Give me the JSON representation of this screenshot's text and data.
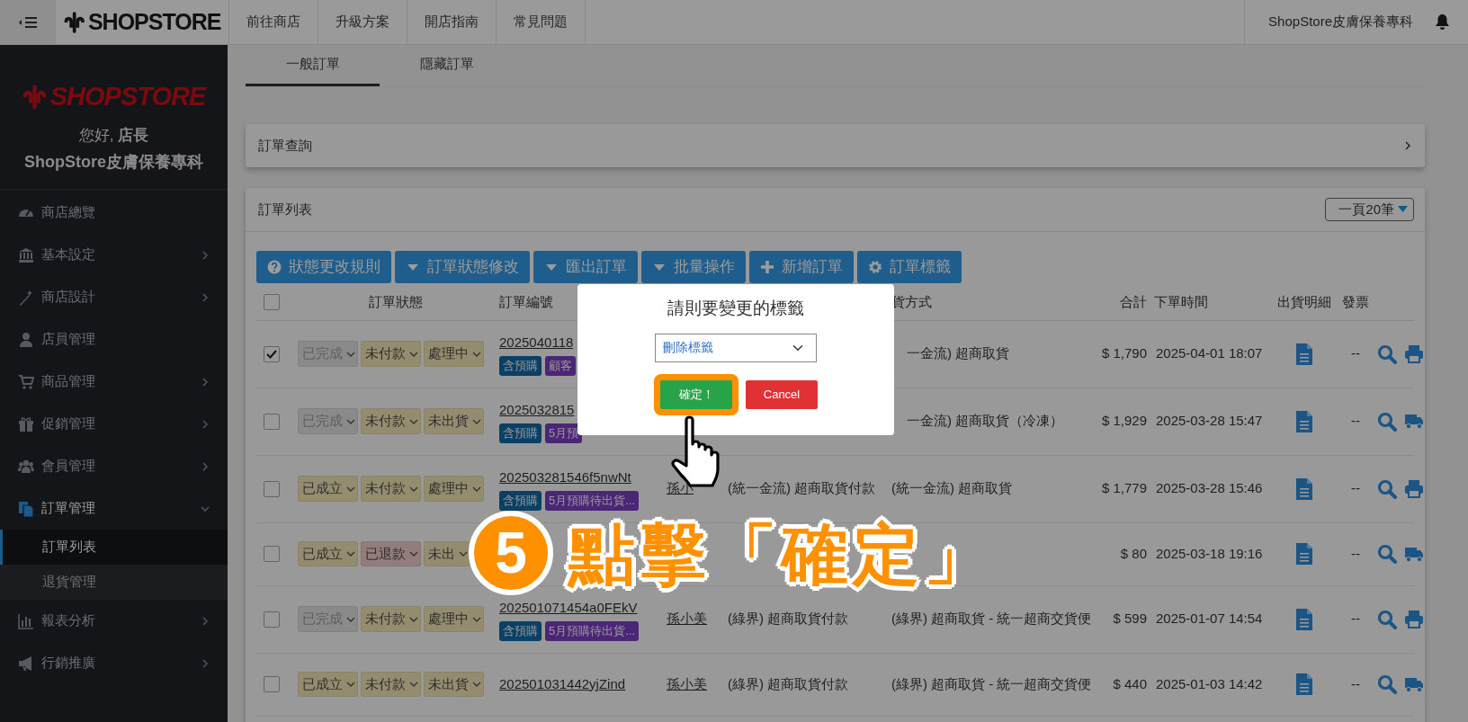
{
  "topbar": {
    "logo_text": "SHOPSTORE",
    "nav": [
      "前往商店",
      "升級方案",
      "開店指南",
      "常見問題"
    ],
    "store_name": "ShopStore皮膚保養專科"
  },
  "sidebar": {
    "logo_text": "SHOPSTORE",
    "greeting": "您好, **店長**",
    "store": "ShopStore皮膚保養專科",
    "items": [
      {
        "label": "商店總覽",
        "selected": false
      },
      {
        "label": "基本設定",
        "selected": false,
        "expanded": false
      },
      {
        "label": "商店設計",
        "selected": false,
        "expanded": false
      },
      {
        "label": "店員管理",
        "selected": false
      },
      {
        "label": "商品管理",
        "selected": false,
        "expanded": false
      },
      {
        "label": "促銷管理",
        "selected": false,
        "expanded": false
      },
      {
        "label": "會員管理",
        "selected": false,
        "expanded": false
      },
      {
        "label": "訂單管理",
        "selected": true,
        "expanded": true,
        "children": [
          {
            "label": "訂單列表",
            "selected": true
          },
          {
            "label": "退貨管理",
            "selected": false
          }
        ]
      },
      {
        "label": "報表分析",
        "selected": false,
        "expanded": false
      },
      {
        "label": "行銷推廣",
        "selected": false,
        "expanded": false
      }
    ]
  },
  "tabs": [
    {
      "label": "一般訂單",
      "selected": true
    },
    {
      "label": "隱藏訂單",
      "selected": false
    }
  ],
  "search_panel": {
    "title": "訂單查詢"
  },
  "order_list": {
    "title": "訂單列表",
    "page_size": "一頁20筆",
    "buttons": [
      "狀態更改規則",
      "訂單狀態修改",
      "匯出訂單",
      "批量操作",
      "新增訂單",
      "訂單標籤"
    ],
    "select_all": {
      "checked": false
    },
    "columns": [
      "訂單狀態",
      "訂單編號",
      "貨方式",
      "合計",
      "下單時間",
      "出貨明細",
      "發票"
    ],
    "rows": [
      {
        "checked": true,
        "statuses": [
          {
            "label": "已完成",
            "color": "#8a8a8a"
          },
          {
            "label": "未付款",
            "color": "#948c6f"
          },
          {
            "label": "處理中",
            "color": "#948c6f"
          }
        ],
        "order_id": "2025040118",
        "tags": [
          {
            "label": "含預購",
            "color": "#0a4065"
          },
          {
            "label": "顧客",
            "color": "#4c2676"
          }
        ],
        "shipping": "一金流) 超商取貨",
        "total": "$ 1,790",
        "time": "2025-04-01 18:07",
        "invoice": "--"
      },
      {
        "checked": false,
        "statuses": [
          {
            "label": "已完成",
            "color": "#8a8a8a"
          },
          {
            "label": "未付款",
            "color": "#948c6f"
          },
          {
            "label": "未出貨",
            "color": "#948c6f"
          }
        ],
        "order_id": "2025032815",
        "tags": [
          {
            "label": "含預購",
            "color": "#0a4065"
          },
          {
            "label": "5月預",
            "color": "#4c2676"
          }
        ],
        "shipping": "一金流) 超商取貨（冷凍）",
        "total": "$ 1,929",
        "time": "2025-03-28 15:47",
        "invoice": "--"
      },
      {
        "checked": false,
        "statuses": [
          {
            "label": "已成立",
            "color": "#948c6f"
          },
          {
            "label": "未付款",
            "color": "#948c6f"
          },
          {
            "label": "處理中",
            "color": "#948c6f"
          }
        ],
        "order_id": "202503281546f5nwNt",
        "tags": [
          {
            "label": "含預購",
            "color": "#0a4065"
          },
          {
            "label": "5月預購待出貨...",
            "color": "#4c2676"
          }
        ],
        "customer": "孫小",
        "payment": "(統一金流) 超商取貨付款",
        "shipping": "(統一金流) 超商取貨",
        "total": "$ 1,779",
        "time": "2025-03-28 15:46",
        "invoice": "--"
      },
      {
        "checked": false,
        "statuses": [
          {
            "label": "已成立",
            "color": "#948c6f"
          },
          {
            "label": "已退款",
            "color": "#927c7c"
          },
          {
            "label": "未出",
            "color": "#948c6f"
          }
        ],
        "tags": [],
        "total": "$ 80",
        "time": "2025-03-18 19:16",
        "invoice": "--"
      },
      {
        "checked": false,
        "statuses": [
          {
            "label": "已完成",
            "color": "#8a8a8a"
          },
          {
            "label": "未付款",
            "color": "#948c6f"
          },
          {
            "label": "處理中",
            "color": "#948c6f"
          }
        ],
        "order_id": "202501071454a0FEkV",
        "tags": [
          {
            "label": "含預購",
            "color": "#0a4065"
          },
          {
            "label": "5月預購待出貨...",
            "color": "#4c2676"
          }
        ],
        "customer": "孫小美",
        "payment": "(綠界) 超商取貨付款",
        "shipping": "(綠界) 超商取貨 - 統一超商交貨便",
        "total": "$ 599",
        "time": "2025-01-07 14:54",
        "invoice": "--"
      },
      {
        "checked": false,
        "statuses": [
          {
            "label": "已成立",
            "color": "#948c6f"
          },
          {
            "label": "未付款",
            "color": "#948c6f"
          },
          {
            "label": "未出貨",
            "color": "#948c6f"
          }
        ],
        "order_id": "202501031442yjZind",
        "tags": [],
        "customer": "孫小美",
        "payment": "(綠界) 超商取貨付款",
        "shipping": "(綠界) 超商取貨 - 統一超商交貨便",
        "total": "$ 440",
        "time": "2025-01-03 14:42",
        "invoice": "--"
      }
    ]
  },
  "modal": {
    "title": "請則要變更的標籤",
    "select_value": "刪除標籤",
    "confirm": "確定！",
    "confirm_highlighted": true,
    "cancel": "Cancel"
  },
  "callout": {
    "step": "5",
    "text": "點擊「確定」"
  }
}
